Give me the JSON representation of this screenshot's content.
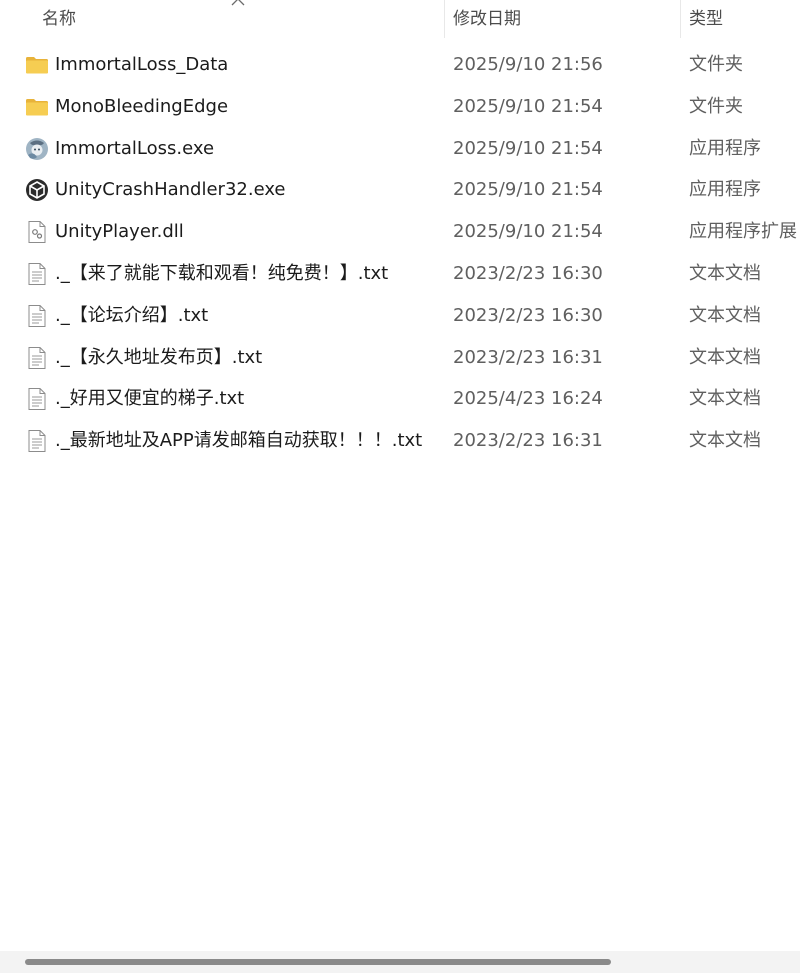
{
  "columns": {
    "name": "名称",
    "date": "修改日期",
    "type": "类型"
  },
  "files": [
    {
      "icon": "folder-icon",
      "name": "ImmortalLoss_Data",
      "date": "2025/9/10 21:56",
      "type": "文件夹"
    },
    {
      "icon": "folder-icon",
      "name": "MonoBleedingEdge",
      "date": "2025/9/10 21:54",
      "type": "文件夹"
    },
    {
      "icon": "game-exe-icon",
      "name": "ImmortalLoss.exe",
      "date": "2025/9/10 21:54",
      "type": "应用程序"
    },
    {
      "icon": "unity-logo-icon",
      "name": "UnityCrashHandler32.exe",
      "date": "2025/9/10 21:54",
      "type": "应用程序"
    },
    {
      "icon": "dll-file-icon",
      "name": "UnityPlayer.dll",
      "date": "2025/9/10 21:54",
      "type": "应用程序扩展"
    },
    {
      "icon": "text-file-icon",
      "name": "._【来了就能下载和观看！纯免费！】.txt",
      "date": "2023/2/23 16:30",
      "type": "文本文档"
    },
    {
      "icon": "text-file-icon",
      "name": "._【论坛介绍】.txt",
      "date": "2023/2/23 16:30",
      "type": "文本文档"
    },
    {
      "icon": "text-file-icon",
      "name": "._【永久地址发布页】.txt",
      "date": "2023/2/23 16:31",
      "type": "文本文档"
    },
    {
      "icon": "text-file-icon",
      "name": "._好用又便宜的梯子.txt",
      "date": "2025/4/23 16:24",
      "type": "文本文档"
    },
    {
      "icon": "text-file-icon",
      "name": "._最新地址及APP请发邮箱自动获取！！！.txt",
      "date": "2023/2/23 16:31",
      "type": "文本文档"
    }
  ],
  "colors": {
    "folder": "#f4c542",
    "accent": "#0067c0"
  }
}
